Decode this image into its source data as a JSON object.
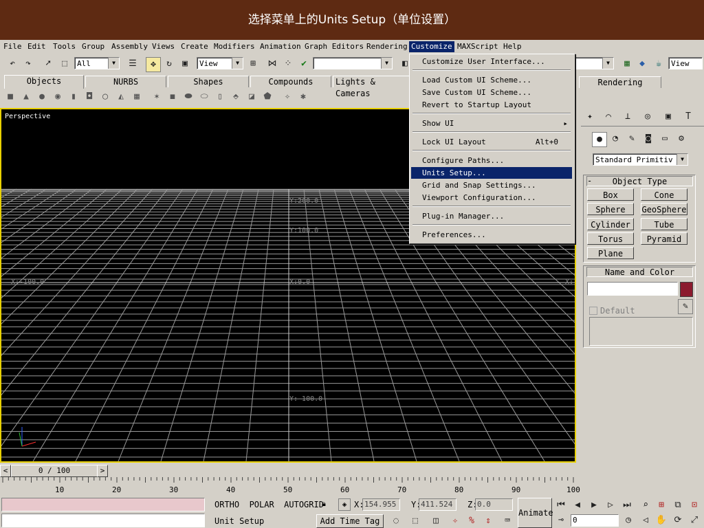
{
  "banner": {
    "title": "选择菜单上的Units Setup（单位设置）"
  },
  "menubar": {
    "items": [
      "File",
      "Edit",
      "Tools",
      "Group",
      "Assembly",
      "Views",
      "Create",
      "Modifiers",
      "Animation",
      "Graph Editors",
      "Rendering",
      "Customize",
      "MAXScript",
      "Help"
    ],
    "active": "Customize"
  },
  "toolbar": {
    "selection_filter": "All",
    "coord_system": "View",
    "right_view": "View"
  },
  "tabs": [
    "Objects",
    "NURBS",
    "Shapes",
    "Compounds",
    "Lights & Cameras",
    "Rendering"
  ],
  "dropdown": {
    "items": [
      {
        "label": "Customize User Interface...",
        "shortcut": ""
      },
      {
        "label": "Load Custom UI Scheme...",
        "shortcut": ""
      },
      {
        "label": "Save Custom UI Scheme...",
        "shortcut": ""
      },
      {
        "label": "Revert to Startup Layout",
        "shortcut": ""
      },
      {
        "label": "Show UI",
        "shortcut": "▸"
      },
      {
        "label": "Lock UI Layout",
        "shortcut": "Alt+0"
      },
      {
        "label": "Configure Paths...",
        "shortcut": ""
      },
      {
        "label": "Units Setup...",
        "shortcut": ""
      },
      {
        "label": "Grid and Snap Settings...",
        "shortcut": ""
      },
      {
        "label": "Viewport Configuration...",
        "shortcut": ""
      },
      {
        "label": "Plug-in Manager...",
        "shortcut": ""
      },
      {
        "label": "Preferences...",
        "shortcut": ""
      }
    ],
    "highlighted": "Units Setup..."
  },
  "viewport": {
    "label": "Perspective",
    "axis_labels": [
      "Y:200.0",
      "Y:100.0",
      "X:-100.0",
      "X:0.0",
      "X:",
      "Y:-100.0"
    ]
  },
  "command_panel": {
    "category": "Standard Primitiv",
    "object_type_title": "Object Type",
    "buttons": [
      "Box",
      "Cone",
      "Sphere",
      "GeoSphere",
      "Cylinder",
      "Tube",
      "Torus",
      "Pyramid",
      "Plane"
    ],
    "name_color_title": "Name and Color",
    "default_label": "Default",
    "color": "#8b1a2e"
  },
  "timeline": {
    "frame": "0 / 100",
    "ticks": [
      "10",
      "20",
      "30",
      "40",
      "50",
      "60",
      "70",
      "80",
      "90",
      "100"
    ]
  },
  "status": {
    "modes": "ORTHO  POLAR  AUTOGRID",
    "x_label": "X:",
    "x": "154.955",
    "y_label": "Y:",
    "y": "411.524",
    "z_label": "Z:",
    "z": "0.0",
    "prompt": "Unit Setup",
    "add_time_tag": "Add Time Tag",
    "animate": "Animate",
    "frame_field": "0"
  }
}
